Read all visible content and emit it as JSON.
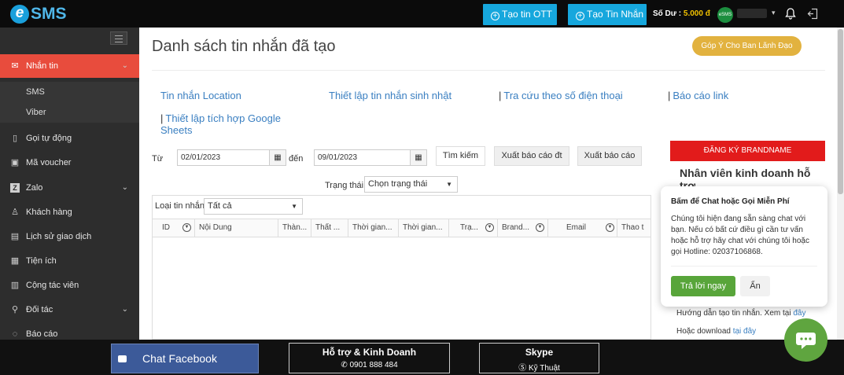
{
  "header": {
    "logo_e": "e",
    "logo_text": "SMS",
    "btn_ott": "Tạo tin OTT",
    "btn_sms": "Tạo Tin Nhắn",
    "balance_label": "Số Dư : ",
    "balance_value": "5.000 đ",
    "avatar_text": "eSMS"
  },
  "sidebar": {
    "items": [
      {
        "label": "Nhắn tin",
        "icon": "envelope-icon"
      },
      {
        "label": "Gọi tự động",
        "icon": "phone-icon"
      },
      {
        "label": "Mã voucher",
        "icon": "gift-icon"
      },
      {
        "label": "Zalo",
        "icon": "zalo-icon"
      },
      {
        "label": "Khách hàng",
        "icon": "user-icon"
      },
      {
        "label": "Lịch sử giao dịch",
        "icon": "book-icon"
      },
      {
        "label": "Tiện ích",
        "icon": "briefcase-icon"
      },
      {
        "label": "Cộng tác viên",
        "icon": "calendar-icon"
      },
      {
        "label": "Đối tác",
        "icon": "handshake-icon"
      },
      {
        "label": "Báo cáo",
        "icon": "comments-icon"
      }
    ],
    "sub": [
      "SMS",
      "Viber"
    ]
  },
  "main": {
    "title": "Danh sách tin nhắn đã tạo",
    "feedback": "Góp Ý Cho Ban Lãnh Đạo",
    "links": [
      "Tin nhắn Location",
      "Thiết lập tin nhắn sinh nhật",
      "Tra cứu theo số điện thoại",
      "Báo cáo link",
      "Thiết lập tích hợp Google Sheets"
    ],
    "from_label": "Từ",
    "from_date": "02/01/2023",
    "to_label": "đến",
    "to_date": "09/01/2023",
    "search": "Tìm kiếm",
    "export1": "Xuất báo cáo đt",
    "export2": "Xuất báo cáo",
    "status_label": "Trạng thái",
    "status_select": "Chọn trạng thái",
    "type_label": "Loại tin nhắn",
    "type_select": "Tất cả",
    "columns": [
      "ID",
      "Nội Dung",
      "Thàn...",
      "Thất ...",
      "Thời gian...",
      "Thời gian...",
      "Trạ...",
      "Brand...",
      "Email",
      "Thao t"
    ]
  },
  "right": {
    "register": "ĐĂNG KÝ BRANDNAME",
    "staff": "Nhân viên kinh doanh hỗ trợ",
    "guide1": "Hướng dẫn tạo tin nhắn. Xem tại ",
    "guide1_link": "đây",
    "guide2": "Hoặc download ",
    "guide2_link": "tại đây"
  },
  "chat_popup": {
    "title": "Bấm để Chat hoặc Gọi Miễn Phí",
    "text": "Chúng tôi hiện đang sẵn sàng chat với bạn. Nếu có bất cứ điều gì cần tư vấn hoặc hỗ trợ hãy chat với chúng tôi hoặc gọi Hotline: 02037106868.",
    "reply": "Trả lời ngay",
    "hide": "Ẩn"
  },
  "footer": {
    "facebook": "Chat Facebook",
    "support_title": "Hỗ trợ & Kinh Doanh",
    "support_phone": "0901 888 484",
    "skype_title": "Skype",
    "skype_sub": "Kỹ Thuật"
  },
  "colors": {
    "accent": "#16a7dd",
    "active": "#e84c3d",
    "brand_red": "#e21b1b",
    "green": "#58a53a"
  }
}
